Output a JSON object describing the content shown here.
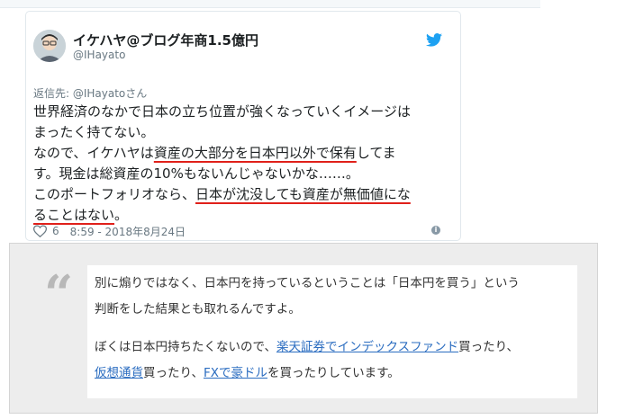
{
  "tweet": {
    "display_name": "イケハヤ@ブログ年商1.5億円",
    "handle": "@IHayato",
    "reply_to": "返信先: @IHayatoさん",
    "lines": [
      [
        "世界経済のなかで日本の立ち位置が強くなっていくイメージは"
      ],
      [
        "まったく持てない。"
      ],
      [
        "なので、イケハヤは",
        "資産の大部分を日本円以外で保有",
        "してま"
      ],
      [
        "す。現金は総資産の10%もないんじゃないかな……。"
      ],
      [
        "このポートフォリオなら、",
        "日本が沈没しても資産が無価値にな"
      ],
      [
        "ることはない",
        "。"
      ]
    ],
    "likes": "6",
    "timestamp": "8:59 - 2018年8月24日",
    "info_symbol": "i",
    "icons": {
      "like": "heart-icon",
      "brand": "twitter-bird-icon",
      "info": "info-icon"
    },
    "underline_color": "#e0201a"
  },
  "quote": {
    "mark": "“",
    "line1": "別に煽りではなく、日本円を持っているということは「日本円を買う」という",
    "line2": "判断をした結果とも取れるんですよ。",
    "line3_pre": "ぼくは日本円持ちたくないので、",
    "link1": "楽天証券でインデックスファンド",
    "line3_post": "買ったり、",
    "link2": "仮想通貨",
    "line4_mid": "買ったり、",
    "link3": "FXで豪ドル",
    "line4_post": "を買ったりしています。",
    "link_color": "#2a6cc0"
  }
}
